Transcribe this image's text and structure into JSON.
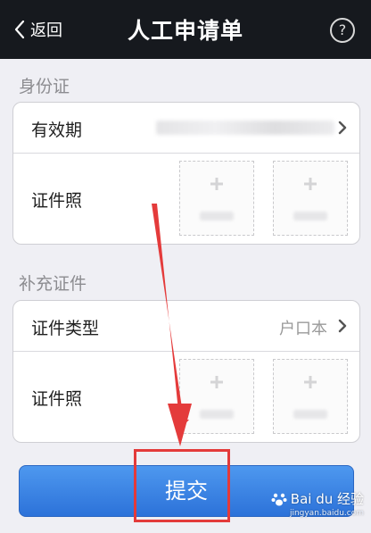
{
  "nav": {
    "back_label": "返回",
    "title": "人工申请单",
    "help_symbol": "?"
  },
  "sections": [
    {
      "header": "身份证",
      "rows": [
        {
          "title": "有效期",
          "value": "",
          "has_chevron": true
        },
        {
          "title": "证件照",
          "photo_slots": 2
        }
      ]
    },
    {
      "header": "补充证件",
      "rows": [
        {
          "title": "证件类型",
          "value": "户口本",
          "has_chevron": true
        },
        {
          "title": "证件照",
          "photo_slots": 2
        }
      ]
    }
  ],
  "submit": {
    "label": "提交"
  },
  "watermark": {
    "text": "Bai du 经验",
    "url": "jingyan.baidu.com"
  },
  "colors": {
    "navbar": "#16191e",
    "background": "#efeff4",
    "submit_button": "#3d86e6",
    "annotation": "#e33a3a"
  }
}
